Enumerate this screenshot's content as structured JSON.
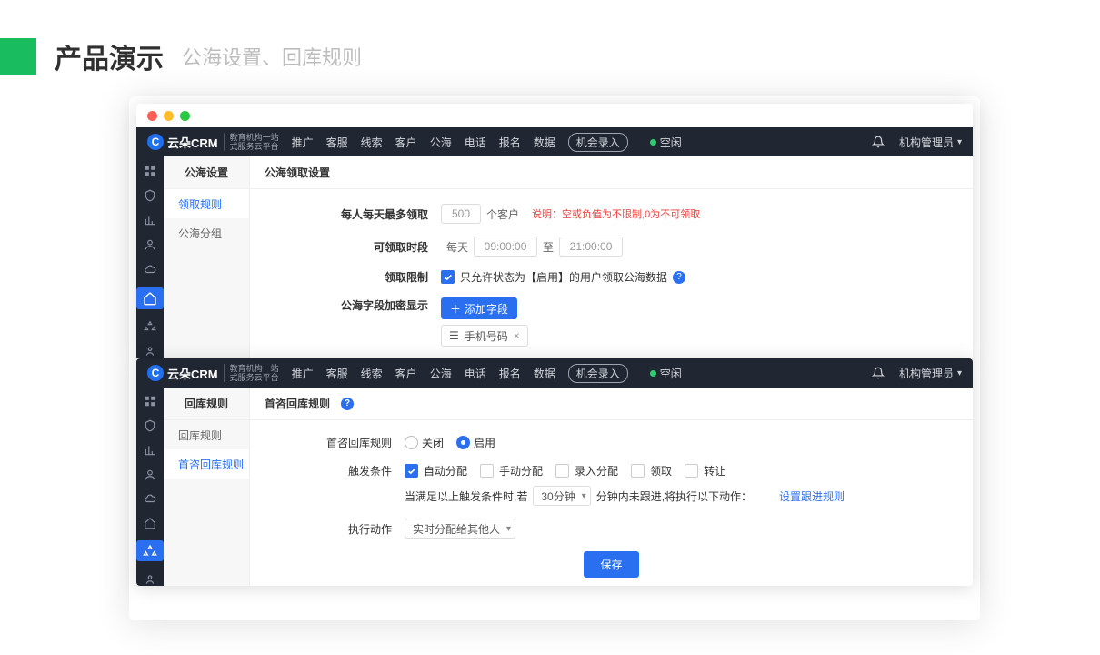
{
  "slide": {
    "title": "产品演示",
    "subtitle": "公海设置、回库规则"
  },
  "brand": {
    "name": "云朵CRM",
    "tag1": "教育机构一站",
    "tag2": "式服务云平台"
  },
  "nav": {
    "items": [
      "推广",
      "客服",
      "线索",
      "客户",
      "公海",
      "电话",
      "报名",
      "数据"
    ],
    "btn": "机会录入",
    "status": "空闲",
    "user": "机构管理员"
  },
  "win1": {
    "sideTitle": "公海设置",
    "sideItems": [
      "领取规则",
      "公海分组"
    ],
    "title": "公海领取设置",
    "f": {
      "l1": "每人每天最多领取",
      "v1": "500",
      "unit1": "个客户",
      "note": "说明：空或负值为不限制,0为不可领取",
      "l2": "可领取时段",
      "daily": "每天",
      "t1": "09:00:00",
      "to": "至",
      "t2": "21:00:00",
      "l3": "领取限制",
      "c3": "只允许状态为【启用】的用户领取公海数据",
      "l4": "公海字段加密显示",
      "addBtn": "添加字段",
      "chip": "手机号码"
    }
  },
  "win2": {
    "sideTitle": "回库规则",
    "sideItems": [
      "回库规则",
      "首咨回库规则"
    ],
    "title": "首咨回库规则",
    "f": {
      "l1": "首咨回库规则",
      "off": "关闭",
      "on": "启用",
      "l2": "触发条件",
      "opts": [
        "自动分配",
        "手动分配",
        "录入分配",
        "领取",
        "转让"
      ],
      "pre": "当满足以上触发条件时,若",
      "sel": "30分钟",
      "mid": "分钟内未跟进,将执行以下动作：",
      "link": "设置跟进规则",
      "l3": "执行动作",
      "act": "实时分配给其他人",
      "save": "保存"
    }
  }
}
